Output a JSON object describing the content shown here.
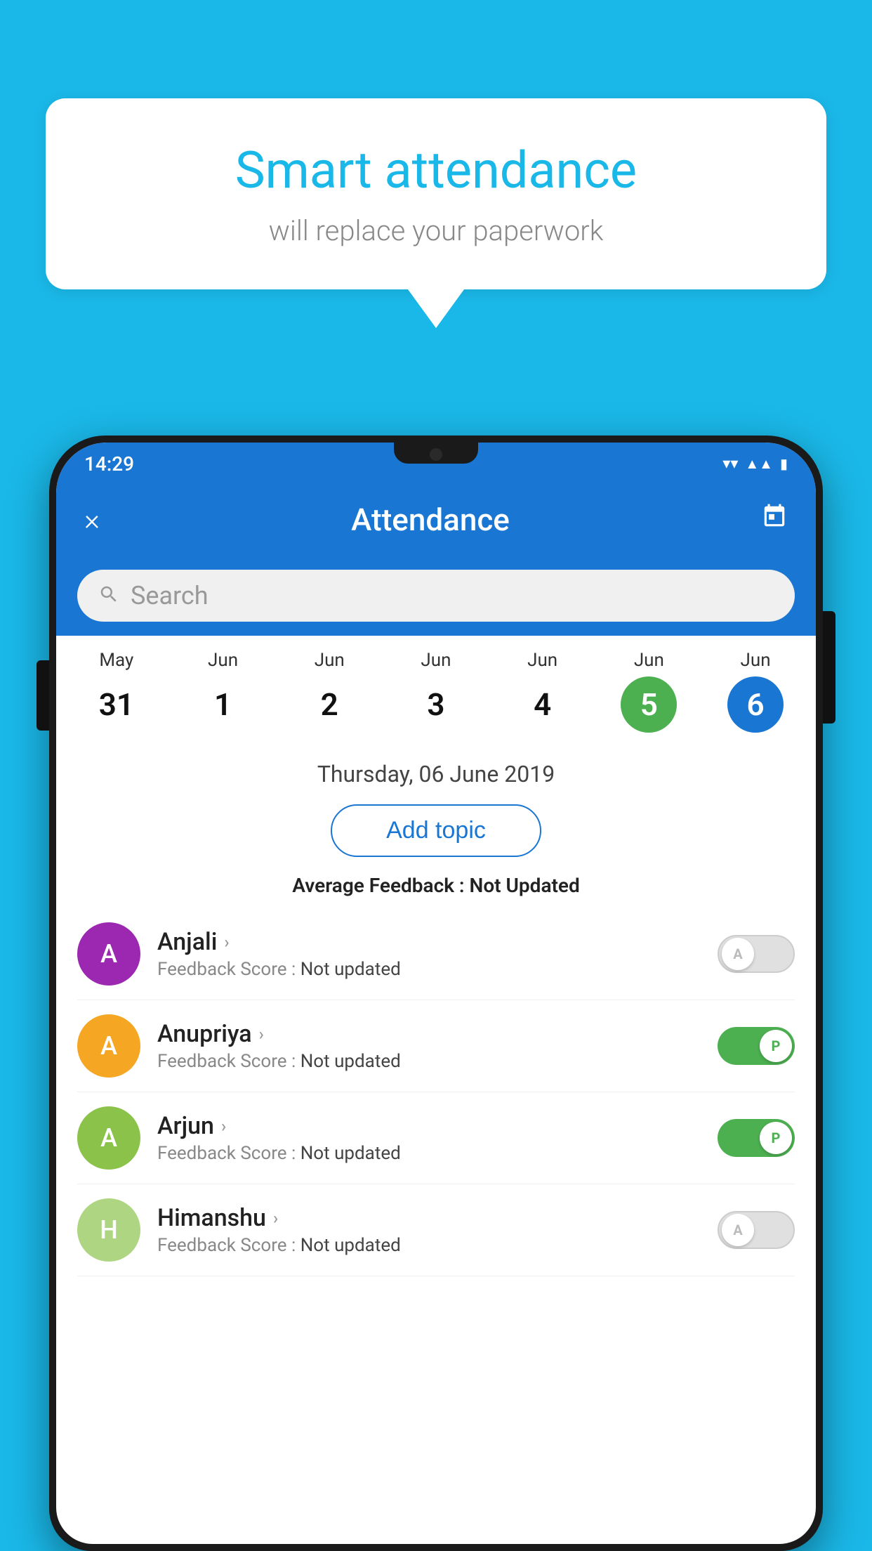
{
  "background_color": "#1ab8e8",
  "hero": {
    "title": "Smart attendance",
    "subtitle": "will replace your paperwork"
  },
  "phone": {
    "status_bar": {
      "time": "14:29",
      "icons": [
        "wifi",
        "signal",
        "battery"
      ]
    },
    "app_bar": {
      "title": "Attendance",
      "close_label": "×",
      "calendar_icon": "📅"
    },
    "search": {
      "placeholder": "Search"
    },
    "calendar": {
      "days": [
        {
          "month": "May",
          "day": "31",
          "state": "normal"
        },
        {
          "month": "Jun",
          "day": "1",
          "state": "normal"
        },
        {
          "month": "Jun",
          "day": "2",
          "state": "normal"
        },
        {
          "month": "Jun",
          "day": "3",
          "state": "normal"
        },
        {
          "month": "Jun",
          "day": "4",
          "state": "normal"
        },
        {
          "month": "Jun",
          "day": "5",
          "state": "today"
        },
        {
          "month": "Jun",
          "day": "6",
          "state": "selected"
        }
      ]
    },
    "selected_date": "Thursday, 06 June 2019",
    "add_topic_label": "Add topic",
    "avg_feedback_label": "Average Feedback :",
    "avg_feedback_value": "Not Updated",
    "students": [
      {
        "name": "Anjali",
        "avatar_letter": "A",
        "avatar_color": "#9c27b0",
        "feedback_label": "Feedback Score :",
        "feedback_value": "Not updated",
        "toggle_state": "off",
        "toggle_label": "A"
      },
      {
        "name": "Anupriya",
        "avatar_letter": "A",
        "avatar_color": "#f5a623",
        "feedback_label": "Feedback Score :",
        "feedback_value": "Not updated",
        "toggle_state": "on",
        "toggle_label": "P"
      },
      {
        "name": "Arjun",
        "avatar_letter": "A",
        "avatar_color": "#8bc34a",
        "feedback_label": "Feedback Score :",
        "feedback_value": "Not updated",
        "toggle_state": "on",
        "toggle_label": "P"
      },
      {
        "name": "Himanshu",
        "avatar_letter": "H",
        "avatar_color": "#aed581",
        "feedback_label": "Feedback Score :",
        "feedback_value": "Not updated",
        "toggle_state": "off",
        "toggle_label": "A"
      }
    ]
  }
}
